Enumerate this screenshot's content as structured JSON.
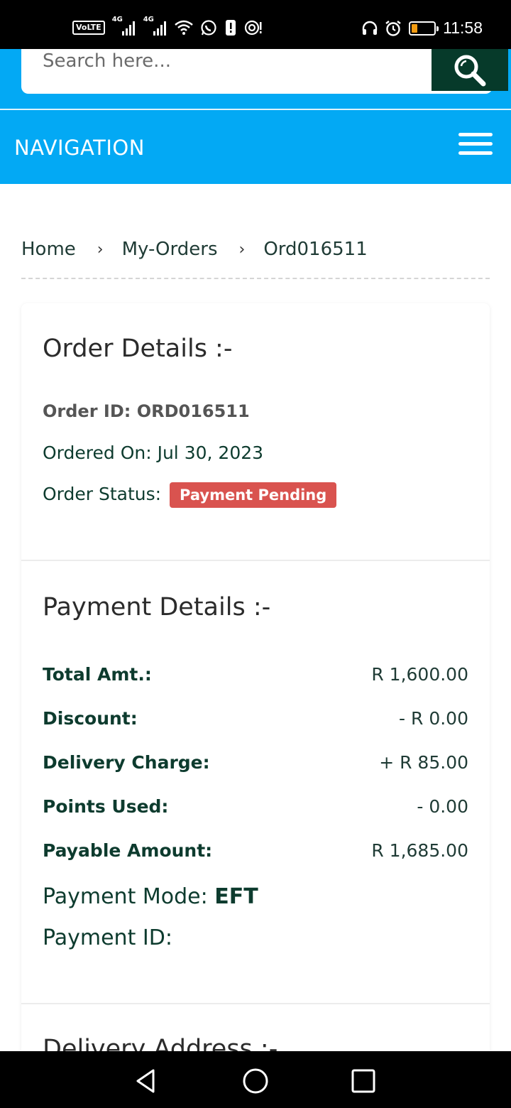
{
  "status_bar": {
    "volte": "VoLTE",
    "network1": "4G",
    "network2": "4G",
    "time": "11:58"
  },
  "search": {
    "placeholder": "Search here..."
  },
  "nav": {
    "title": "NAVIGATION"
  },
  "breadcrumb": {
    "items": [
      "Home",
      "My-Orders",
      "Ord016511"
    ],
    "separator": "›"
  },
  "order_details": {
    "title": "Order Details :-",
    "order_id_label": "Order ID: ORD016511",
    "ordered_on_label": "Ordered On:",
    "ordered_on_value": "Jul 30, 2023",
    "status_label": "Order Status:",
    "status_value": "Payment Pending",
    "status_color": "#d9534f"
  },
  "payment_details": {
    "title": "Payment Details :-",
    "rows": [
      {
        "label": "Total Amt.:",
        "value": "R 1,600.00"
      },
      {
        "label": "Discount:",
        "value": "- R 0.00"
      },
      {
        "label": "Delivery Charge:",
        "value": "+ R 85.00"
      },
      {
        "label": "Points Used:",
        "value": "- 0.00"
      },
      {
        "label": "Payable Amount:",
        "value": "R 1,685.00"
      }
    ],
    "payment_mode_label": "Payment Mode:",
    "payment_mode_value": "EFT",
    "payment_id_label": "Payment ID:"
  },
  "delivery": {
    "title": "Delivery Address :-"
  },
  "colors": {
    "accent": "#03a9f4",
    "search_button": "#063a2a",
    "text_dark_green": "#0d3b2e"
  }
}
